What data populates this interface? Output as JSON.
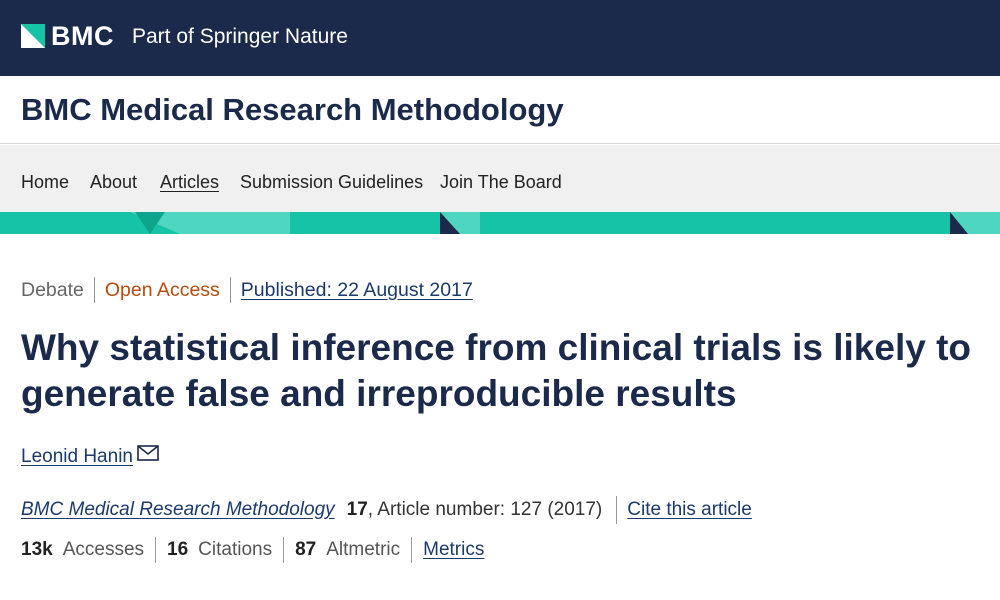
{
  "header": {
    "logo_text": "BMC",
    "tagline": "Part of Springer Nature"
  },
  "journal": {
    "title": "BMC Medical Research Methodology"
  },
  "nav": {
    "items": [
      {
        "label": "Home"
      },
      {
        "label": "About"
      },
      {
        "label": "Articles",
        "active": true
      },
      {
        "label": "Submission Guidelines"
      },
      {
        "label": "Join The Board"
      }
    ]
  },
  "article": {
    "type": "Debate",
    "access": "Open Access",
    "published": "Published: 22 August 2017",
    "title": "Why statistical inference from clinical trials is likely to generate false and irreproducible results",
    "author": "Leonid Hanin",
    "citation": {
      "journal": "BMC Medical Research Methodology",
      "volume": "17",
      "rest": ", Article number: 127 (2017)",
      "cite_link": "Cite this article"
    },
    "metrics": {
      "accesses_value": "13k",
      "accesses_label": "Accesses",
      "citations_value": "16",
      "citations_label": "Citations",
      "altmetric_value": "87",
      "altmetric_label": "Altmetric",
      "metrics_link": "Metrics"
    }
  },
  "colors": {
    "header_bg": "#1b2a4a",
    "teal": "#17c3a6",
    "open_access": "#b84b0e",
    "link": "#1b3a6b"
  }
}
